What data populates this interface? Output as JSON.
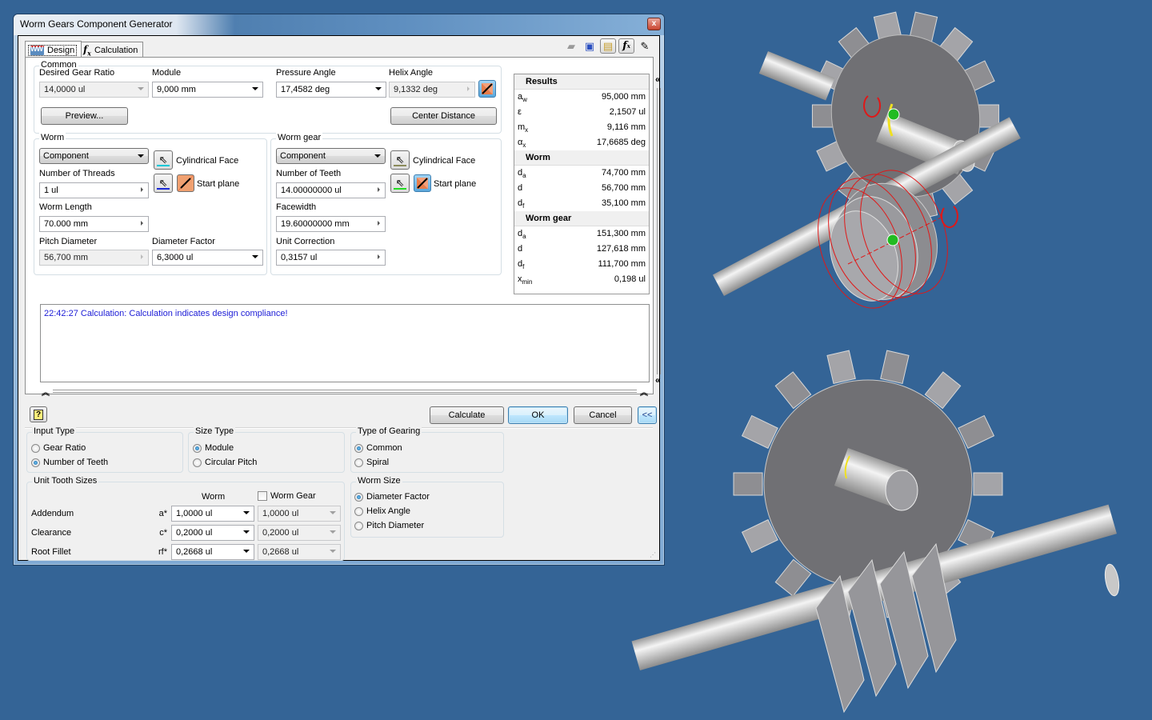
{
  "window": {
    "title": "Worm Gears Component Generator",
    "close_label": "x"
  },
  "tabs": [
    {
      "label": "Design",
      "icon": "worm-gear-icon",
      "active": true
    },
    {
      "label": "Calculation",
      "icon": "fx-icon",
      "active": false
    }
  ],
  "toolbar": {
    "icons": [
      "open-folder-icon",
      "save-icon",
      "results-panel-icon",
      "calculation-fx-icon",
      "notes-icon"
    ]
  },
  "common": {
    "label": "Common",
    "desired_gear_ratio": {
      "label": "Desired Gear Ratio",
      "value": "14,0000 ul"
    },
    "module": {
      "label": "Module",
      "value": "9,000 mm"
    },
    "pressure_angle": {
      "label": "Pressure Angle",
      "value": "17,4582 deg"
    },
    "helix_angle": {
      "label": "Helix Angle",
      "value": "9,1332 deg"
    },
    "preview_label": "Preview...",
    "center_distance_label": "Center Distance"
  },
  "worm": {
    "label": "Worm",
    "type_value": "Component",
    "cylindrical_face_label": "Cylindrical Face",
    "start_plane_label": "Start plane",
    "threads": {
      "label": "Number of Threads",
      "value": "1 ul"
    },
    "length": {
      "label": "Worm Length",
      "value": "70.000 mm"
    },
    "pitch_diameter": {
      "label": "Pitch Diameter",
      "value": "56,700 mm"
    },
    "diameter_factor": {
      "label": "Diameter Factor",
      "value": "6,3000 ul"
    },
    "face_color": "#00c8d8",
    "plane_color": "#1a2ad6"
  },
  "worm_gear": {
    "label": "Worm gear",
    "type_value": "Component",
    "cylindrical_face_label": "Cylindrical Face",
    "start_plane_label": "Start plane",
    "teeth": {
      "label": "Number of Teeth",
      "value": "14.00000000 ul"
    },
    "facewidth": {
      "label": "Facewidth",
      "value": "19.60000000 mm"
    },
    "unit_correction": {
      "label": "Unit Correction",
      "value": "0,3157 ul"
    },
    "face_color": "#8a8a5a",
    "plane_color": "#22dd22"
  },
  "results": {
    "title": "Results",
    "general": [
      {
        "sym": "a",
        "sub": "w",
        "value": "95,000 mm"
      },
      {
        "sym": "ε",
        "sub": "",
        "value": "2,1507 ul"
      },
      {
        "sym": "m",
        "sub": "x",
        "value": "9,116 mm"
      },
      {
        "sym": "α",
        "sub": "x",
        "value": "17,6685 deg"
      }
    ],
    "worm_title": "Worm",
    "worm": [
      {
        "sym": "d",
        "sub": "a",
        "value": "74,700 mm"
      },
      {
        "sym": "d",
        "sub": "",
        "value": "56,700 mm"
      },
      {
        "sym": "d",
        "sub": "f",
        "value": "35,100 mm"
      }
    ],
    "gear_title": "Worm gear",
    "gear": [
      {
        "sym": "d",
        "sub": "a",
        "value": "151,300 mm"
      },
      {
        "sym": "d",
        "sub": "",
        "value": "127,618 mm"
      },
      {
        "sym": "d",
        "sub": "f",
        "value": "111,700 mm"
      },
      {
        "sym": "x",
        "sub": "min",
        "value": "0,198 ul"
      }
    ]
  },
  "messages": [
    "22:42:27 Calculation: Calculation indicates design compliance!"
  ],
  "buttons": {
    "help": "?",
    "calculate": "Calculate",
    "ok": "OK",
    "cancel": "Cancel",
    "collapse": "<<"
  },
  "input_type": {
    "label": "Input Type",
    "options": [
      {
        "label": "Gear Ratio",
        "selected": false
      },
      {
        "label": "Number of Teeth",
        "selected": true
      }
    ]
  },
  "size_type": {
    "label": "Size Type",
    "options": [
      {
        "label": "Module",
        "selected": true
      },
      {
        "label": "Circular Pitch",
        "selected": false
      }
    ]
  },
  "type_of_gearing": {
    "label": "Type of Gearing",
    "options": [
      {
        "label": "Common",
        "selected": true
      },
      {
        "label": "Spiral",
        "selected": false
      }
    ]
  },
  "worm_size": {
    "label": "Worm Size",
    "options": [
      {
        "label": "Diameter Factor",
        "selected": true
      },
      {
        "label": "Helix Angle",
        "selected": false
      },
      {
        "label": "Pitch Diameter",
        "selected": false
      }
    ]
  },
  "unit_tooth_sizes": {
    "label": "Unit Tooth Sizes",
    "col_worm": "Worm",
    "col_gear": "Worm Gear",
    "gear_checked": false,
    "rows": [
      {
        "label": "Addendum",
        "sym": "a*",
        "worm": "1,0000 ul",
        "gear": "1,0000 ul"
      },
      {
        "label": "Clearance",
        "sym": "c*",
        "worm": "0,2000 ul",
        "gear": "0,2000 ul"
      },
      {
        "label": "Root Fillet",
        "sym": "rf*",
        "worm": "0,2668 ul",
        "gear": "0,2668 ul"
      }
    ]
  },
  "viewport": {
    "background": "#346496",
    "gear_teeth": 14,
    "highlight_color": "#e01818",
    "marker_color": "#22bb22"
  }
}
